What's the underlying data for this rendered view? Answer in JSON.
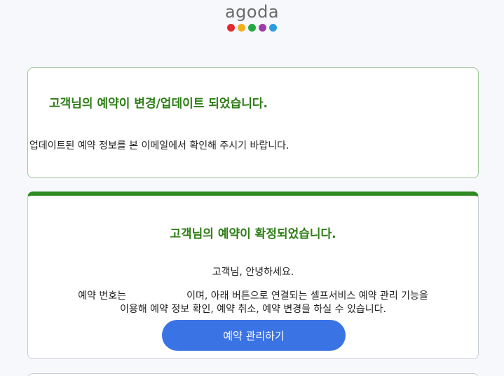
{
  "brand": {
    "name": "agoda",
    "dot_colors": [
      "#e5292f",
      "#f2b01e",
      "#24a844",
      "#9b3ea6",
      "#2b9ddc"
    ]
  },
  "update_notice": {
    "title": "고객님의 예약이 변경/업데이트 되었습니다.",
    "body": "업데이트된 예약 정보를 본 이메일에서 확인해 주시기 바랍니다."
  },
  "confirmation": {
    "title": "고객님의 예약이 확정되었습니다.",
    "greeting": "고객님, 안녕하세요.",
    "booking_prefix": "예약 번호는",
    "booking_suffix": "이며, 아래 버튼으로 연결되는 셀프서비스 예약 관리 기능을",
    "line_2": "이용해 예약 정보 확인, 예약 취소, 예약 변경을 하실 수 있습니다.",
    "manage_button_label": "예약 관리하기"
  },
  "colors": {
    "accent_green": "#2e7d16",
    "button_blue": "#3a73e4"
  }
}
